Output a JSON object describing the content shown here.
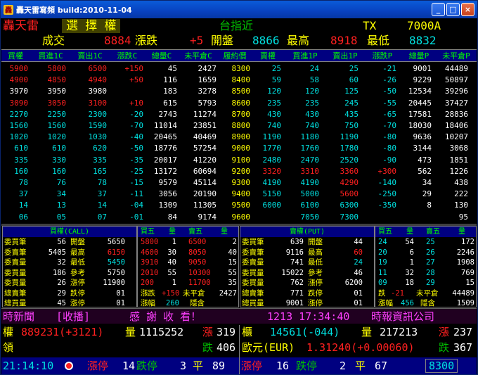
{
  "window": {
    "title": "轟天雷寫頻 build:2010-11-04",
    "min": "_",
    "max": "□",
    "close": "×"
  },
  "header": {
    "app_name": "轟天雷",
    "select_label": "選 擇 權",
    "market_label": "台指近",
    "symbol": "TX",
    "contract": "7000A",
    "deal_label": "成交",
    "deal_value": "8884",
    "change_label": "漲跌",
    "change_value": "+5",
    "open_label": "開盤",
    "open_value": "8866",
    "high_label": "最高",
    "high_value": "8918",
    "low_label": "最低",
    "low_value": "8832"
  },
  "columns": [
    "買權",
    "買進1C",
    "賣出1C",
    "漲跌C",
    "總量C",
    "未平倉C",
    "履約價",
    "賣權",
    "買進1P",
    "賣出1P",
    "漲跌P",
    "總量P",
    "未平倉P"
  ],
  "rows": [
    [
      "5900",
      "5800",
      "6500",
      "+150",
      "45",
      "2427",
      "8300",
      "25",
      "24",
      "25",
      "-21",
      "9001",
      "44489"
    ],
    [
      "4900",
      "4850",
      "4940",
      "+50",
      "116",
      "1659",
      "8400",
      "59",
      "58",
      "60",
      "-26",
      "9229",
      "50897"
    ],
    [
      "3970",
      "3950",
      "3980",
      "",
      "183",
      "3278",
      "8500",
      "120",
      "120",
      "125",
      "-50",
      "12534",
      "39296"
    ],
    [
      "3090",
      "3050",
      "3100",
      "+10",
      "615",
      "5793",
      "8600",
      "235",
      "235",
      "245",
      "-55",
      "20445",
      "37427"
    ],
    [
      "2270",
      "2250",
      "2300",
      "-20",
      "2743",
      "11274",
      "8700",
      "430",
      "430",
      "435",
      "-65",
      "17581",
      "28836"
    ],
    [
      "1560",
      "1560",
      "1590",
      "-70",
      "11014",
      "23851",
      "8800",
      "740",
      "740",
      "750",
      "-70",
      "18030",
      "18406"
    ],
    [
      "1020",
      "1020",
      "1030",
      "-40",
      "20465",
      "40469",
      "8900",
      "1190",
      "1180",
      "1190",
      "-80",
      "9636",
      "10207"
    ],
    [
      "610",
      "610",
      "620",
      "-50",
      "18776",
      "57254",
      "9000",
      "1770",
      "1760",
      "1780",
      "-80",
      "3144",
      "3068"
    ],
    [
      "335",
      "330",
      "335",
      "-35",
      "20017",
      "41220",
      "9100",
      "2480",
      "2470",
      "2520",
      "-90",
      "473",
      "1851"
    ],
    [
      "160",
      "160",
      "165",
      "-25",
      "13172",
      "60694",
      "9200",
      "3320",
      "3310",
      "3360",
      "+300",
      "562",
      "1226"
    ],
    [
      "78",
      "76",
      "78",
      "-15",
      "9579",
      "45114",
      "9300",
      "4190",
      "4190",
      "4290",
      "-140",
      "34",
      "438"
    ],
    [
      "37",
      "34",
      "37",
      "-11",
      "3056",
      "20190",
      "9400",
      "5150",
      "5000",
      "5600",
      "-250",
      "29",
      "222"
    ],
    [
      "14",
      "13",
      "14",
      "-04",
      "1309",
      "11305",
      "9500",
      "6000",
      "6100",
      "6300",
      "-350",
      "8",
      "130"
    ],
    [
      "06",
      "05",
      "07",
      "-01",
      "84",
      "9174",
      "9600",
      "",
      "7050",
      "7300",
      "",
      "",
      "95"
    ]
  ],
  "call_panel": {
    "title": "買權(CALL)",
    "left": [
      [
        "委買筆",
        "56"
      ],
      [
        "委賣筆",
        "5405"
      ],
      [
        "委賣量",
        "32"
      ],
      [
        "委買量",
        "186"
      ],
      [
        "委買量",
        "26"
      ],
      [
        "總賣筆",
        "29"
      ],
      [
        "總買量",
        "45"
      ]
    ],
    "right": [
      [
        "開盤",
        "5650"
      ],
      [
        "最高",
        "6150"
      ],
      [
        "最低",
        "5450"
      ],
      [
        "參考",
        "5750"
      ],
      [
        "漲停",
        "11900"
      ],
      [
        "跌停",
        "01"
      ],
      [
        "漲停",
        "01"
      ]
    ]
  },
  "call_book": {
    "title": [
      "買五",
      "量",
      "賣五",
      "量"
    ],
    "rows": [
      [
        "5800",
        "1",
        "6500",
        "2"
      ],
      [
        "4600",
        "30",
        "8050",
        "40"
      ],
      [
        "3910",
        "40",
        "9050",
        "15"
      ],
      [
        "2010",
        "55",
        "10300",
        "55"
      ],
      [
        "200",
        "1",
        "11700",
        "35"
      ]
    ],
    "chg_label": "漲跌",
    "chg_value": "+150",
    "oi_label": "未平倉",
    "oi_value": "2427",
    "amp_label": "漲幅",
    "amp_value": "260",
    "rel_label": "隱含"
  },
  "put_panel": {
    "title": "賣權(PUT)",
    "left": [
      [
        "委買筆",
        "639"
      ],
      [
        "委賣筆",
        "9116"
      ],
      [
        "委賣量",
        "741"
      ],
      [
        "委買量",
        "15022"
      ],
      [
        "委買量",
        "762"
      ],
      [
        "總賣筆",
        "771"
      ],
      [
        "總買量",
        "9001"
      ]
    ],
    "right": [
      [
        "開盤",
        "44"
      ],
      [
        "最高",
        "60"
      ],
      [
        "最低",
        "24"
      ],
      [
        "參考",
        "46"
      ],
      [
        "漲停",
        "6200"
      ],
      [
        "跌停",
        "01"
      ],
      [
        "漲停",
        "01"
      ]
    ]
  },
  "put_book": {
    "title": [
      "買五",
      "量",
      "賣五",
      "量"
    ],
    "rows": [
      [
        "24",
        "54",
        "25",
        "172"
      ],
      [
        "20",
        "6",
        "26",
        "2246"
      ],
      [
        "19",
        "1",
        "27",
        "1908"
      ],
      [
        "11",
        "32",
        "28",
        "769"
      ],
      [
        "09",
        "18",
        "29",
        "15"
      ]
    ],
    "chg_label": "跌",
    "chg_value": "-21",
    "oi_label": "未平倉",
    "oi_value": "44489",
    "amp_label": "漲幅",
    "amp_value": "456",
    "rel_label": "隱含",
    "rel_value": "1509"
  },
  "news": {
    "label": "時新聞",
    "tag": "收播",
    "message": "感 謝 收 看！",
    "time": "1213 17:34:40",
    "source": "時報資訊公司"
  },
  "bottom": {
    "l1_label": "權",
    "l1_value": "889231(+3121)",
    "l1_qty_label": "量",
    "l1_qty": "1115252",
    "l1_up_label": "漲",
    "l1_up": "319",
    "l2_label": "領",
    "l2_dn_label": "跌",
    "l2_dn": "406",
    "r1_label": "櫃",
    "r1_value": "14561(-044)",
    "r1_qty_label": "量",
    "r1_qty": "217213",
    "r1_up_label": "漲",
    "r1_up": "237",
    "r2_label": "歐元(EUR)",
    "r2_value": "1.31240(+0.00060)",
    "r2_dn_label": "跌",
    "r2_dn": "367",
    "clock": "21:14:10",
    "lim_up_label": "漲停",
    "lim_up": "14",
    "lim_dn_label": "跌停",
    "lim_dn": "3",
    "flat_label": "平",
    "flat": "89",
    "r_lim_up": "16",
    "r_lim_dn": "2",
    "r_flat": "67",
    "index_box": "8300"
  }
}
